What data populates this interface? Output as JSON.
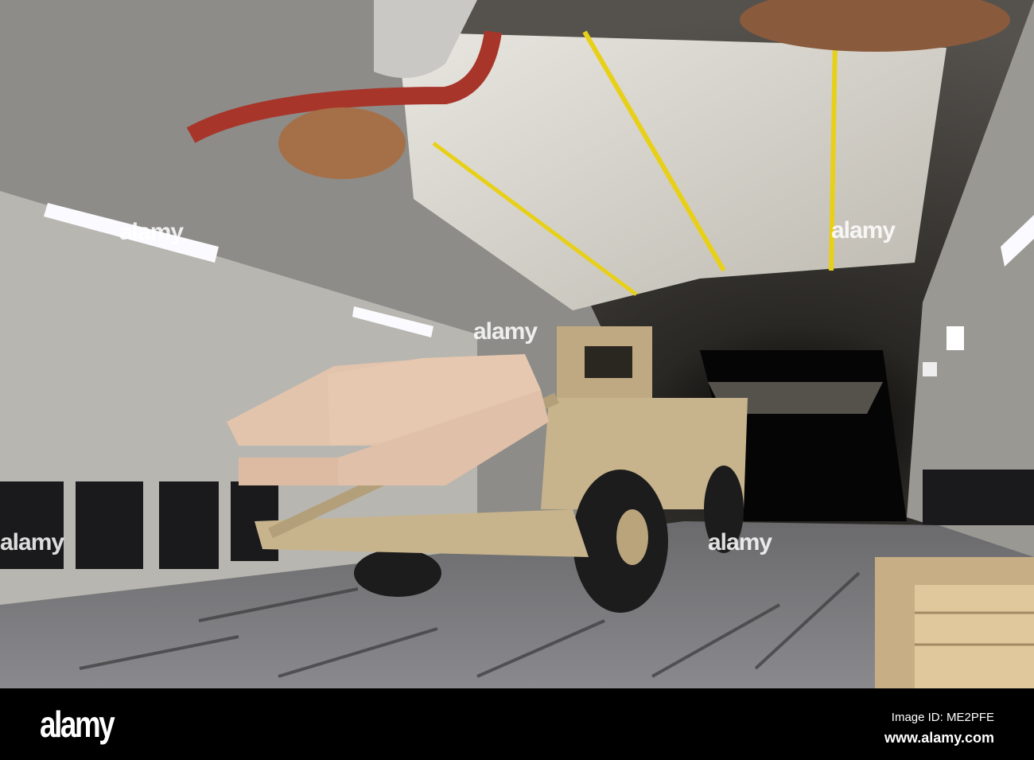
{
  "watermark": {
    "text": "alamy"
  },
  "footer": {
    "logo": "alamy",
    "image_id": "Image ID: ME2PFE",
    "website": "www.alamy.com"
  },
  "colors": {
    "strap": "#e8d018",
    "vehicle": "#c8b48c",
    "pads": "#e0c0a8",
    "duct": "#a8352a",
    "crate": "#d8bf94"
  }
}
